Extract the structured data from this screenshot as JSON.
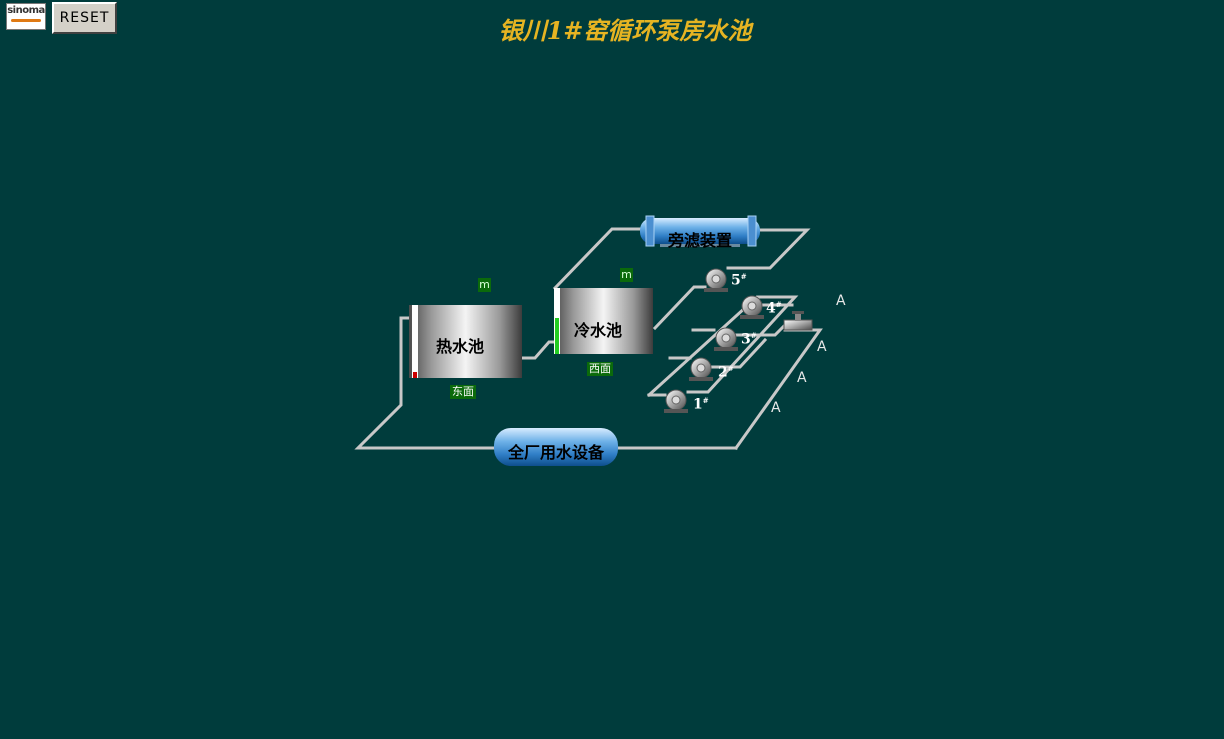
{
  "header": {
    "logo_text": "sinoma",
    "reset_label": "RESET",
    "title": "银川1#窑循环泵房水池"
  },
  "tanks": {
    "hot": {
      "label": "热水池",
      "unit": "m",
      "location": "东面",
      "level": 0.08,
      "bar_color": "#cc0000"
    },
    "cold": {
      "label": "冷水池",
      "unit": "m",
      "location": "西面",
      "level": 0.55,
      "bar_color": "#22cc22"
    }
  },
  "filter": {
    "label": "旁滤装置"
  },
  "plant": {
    "label": "全厂用水设备"
  },
  "pumps": [
    {
      "label": "1",
      "mark": "#"
    },
    {
      "label": "2",
      "mark": "#"
    },
    {
      "label": "3",
      "mark": "#"
    },
    {
      "label": "4",
      "mark": "#"
    },
    {
      "label": "5",
      "mark": "#"
    }
  ],
  "valves": {
    "a_labels": [
      "A",
      "A",
      "A",
      "A"
    ]
  },
  "colors": {
    "background": "#003c3c",
    "title": "#e6b422",
    "pipe": "#c8c8c8",
    "badge": "#0b6a0b"
  }
}
